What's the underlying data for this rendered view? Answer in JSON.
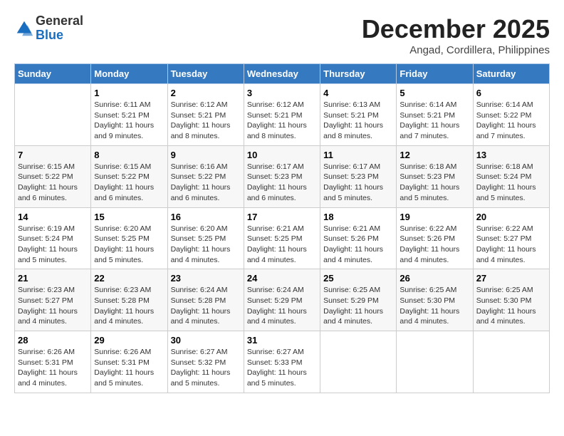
{
  "header": {
    "logo": {
      "general": "General",
      "blue": "Blue"
    },
    "title": "December 2025",
    "subtitle": "Angad, Cordillera, Philippines"
  },
  "days_of_week": [
    "Sunday",
    "Monday",
    "Tuesday",
    "Wednesday",
    "Thursday",
    "Friday",
    "Saturday"
  ],
  "weeks": [
    [
      {
        "day": "",
        "sunrise": "",
        "sunset": "",
        "daylight": ""
      },
      {
        "day": "1",
        "sunrise": "Sunrise: 6:11 AM",
        "sunset": "Sunset: 5:21 PM",
        "daylight": "Daylight: 11 hours and 9 minutes."
      },
      {
        "day": "2",
        "sunrise": "Sunrise: 6:12 AM",
        "sunset": "Sunset: 5:21 PM",
        "daylight": "Daylight: 11 hours and 8 minutes."
      },
      {
        "day": "3",
        "sunrise": "Sunrise: 6:12 AM",
        "sunset": "Sunset: 5:21 PM",
        "daylight": "Daylight: 11 hours and 8 minutes."
      },
      {
        "day": "4",
        "sunrise": "Sunrise: 6:13 AM",
        "sunset": "Sunset: 5:21 PM",
        "daylight": "Daylight: 11 hours and 8 minutes."
      },
      {
        "day": "5",
        "sunrise": "Sunrise: 6:14 AM",
        "sunset": "Sunset: 5:21 PM",
        "daylight": "Daylight: 11 hours and 7 minutes."
      },
      {
        "day": "6",
        "sunrise": "Sunrise: 6:14 AM",
        "sunset": "Sunset: 5:22 PM",
        "daylight": "Daylight: 11 hours and 7 minutes."
      }
    ],
    [
      {
        "day": "7",
        "sunrise": "Sunrise: 6:15 AM",
        "sunset": "Sunset: 5:22 PM",
        "daylight": "Daylight: 11 hours and 6 minutes."
      },
      {
        "day": "8",
        "sunrise": "Sunrise: 6:15 AM",
        "sunset": "Sunset: 5:22 PM",
        "daylight": "Daylight: 11 hours and 6 minutes."
      },
      {
        "day": "9",
        "sunrise": "Sunrise: 6:16 AM",
        "sunset": "Sunset: 5:22 PM",
        "daylight": "Daylight: 11 hours and 6 minutes."
      },
      {
        "day": "10",
        "sunrise": "Sunrise: 6:17 AM",
        "sunset": "Sunset: 5:23 PM",
        "daylight": "Daylight: 11 hours and 6 minutes."
      },
      {
        "day": "11",
        "sunrise": "Sunrise: 6:17 AM",
        "sunset": "Sunset: 5:23 PM",
        "daylight": "Daylight: 11 hours and 5 minutes."
      },
      {
        "day": "12",
        "sunrise": "Sunrise: 6:18 AM",
        "sunset": "Sunset: 5:23 PM",
        "daylight": "Daylight: 11 hours and 5 minutes."
      },
      {
        "day": "13",
        "sunrise": "Sunrise: 6:18 AM",
        "sunset": "Sunset: 5:24 PM",
        "daylight": "Daylight: 11 hours and 5 minutes."
      }
    ],
    [
      {
        "day": "14",
        "sunrise": "Sunrise: 6:19 AM",
        "sunset": "Sunset: 5:24 PM",
        "daylight": "Daylight: 11 hours and 5 minutes."
      },
      {
        "day": "15",
        "sunrise": "Sunrise: 6:20 AM",
        "sunset": "Sunset: 5:25 PM",
        "daylight": "Daylight: 11 hours and 5 minutes."
      },
      {
        "day": "16",
        "sunrise": "Sunrise: 6:20 AM",
        "sunset": "Sunset: 5:25 PM",
        "daylight": "Daylight: 11 hours and 4 minutes."
      },
      {
        "day": "17",
        "sunrise": "Sunrise: 6:21 AM",
        "sunset": "Sunset: 5:25 PM",
        "daylight": "Daylight: 11 hours and 4 minutes."
      },
      {
        "day": "18",
        "sunrise": "Sunrise: 6:21 AM",
        "sunset": "Sunset: 5:26 PM",
        "daylight": "Daylight: 11 hours and 4 minutes."
      },
      {
        "day": "19",
        "sunrise": "Sunrise: 6:22 AM",
        "sunset": "Sunset: 5:26 PM",
        "daylight": "Daylight: 11 hours and 4 minutes."
      },
      {
        "day": "20",
        "sunrise": "Sunrise: 6:22 AM",
        "sunset": "Sunset: 5:27 PM",
        "daylight": "Daylight: 11 hours and 4 minutes."
      }
    ],
    [
      {
        "day": "21",
        "sunrise": "Sunrise: 6:23 AM",
        "sunset": "Sunset: 5:27 PM",
        "daylight": "Daylight: 11 hours and 4 minutes."
      },
      {
        "day": "22",
        "sunrise": "Sunrise: 6:23 AM",
        "sunset": "Sunset: 5:28 PM",
        "daylight": "Daylight: 11 hours and 4 minutes."
      },
      {
        "day": "23",
        "sunrise": "Sunrise: 6:24 AM",
        "sunset": "Sunset: 5:28 PM",
        "daylight": "Daylight: 11 hours and 4 minutes."
      },
      {
        "day": "24",
        "sunrise": "Sunrise: 6:24 AM",
        "sunset": "Sunset: 5:29 PM",
        "daylight": "Daylight: 11 hours and 4 minutes."
      },
      {
        "day": "25",
        "sunrise": "Sunrise: 6:25 AM",
        "sunset": "Sunset: 5:29 PM",
        "daylight": "Daylight: 11 hours and 4 minutes."
      },
      {
        "day": "26",
        "sunrise": "Sunrise: 6:25 AM",
        "sunset": "Sunset: 5:30 PM",
        "daylight": "Daylight: 11 hours and 4 minutes."
      },
      {
        "day": "27",
        "sunrise": "Sunrise: 6:25 AM",
        "sunset": "Sunset: 5:30 PM",
        "daylight": "Daylight: 11 hours and 4 minutes."
      }
    ],
    [
      {
        "day": "28",
        "sunrise": "Sunrise: 6:26 AM",
        "sunset": "Sunset: 5:31 PM",
        "daylight": "Daylight: 11 hours and 4 minutes."
      },
      {
        "day": "29",
        "sunrise": "Sunrise: 6:26 AM",
        "sunset": "Sunset: 5:31 PM",
        "daylight": "Daylight: 11 hours and 5 minutes."
      },
      {
        "day": "30",
        "sunrise": "Sunrise: 6:27 AM",
        "sunset": "Sunset: 5:32 PM",
        "daylight": "Daylight: 11 hours and 5 minutes."
      },
      {
        "day": "31",
        "sunrise": "Sunrise: 6:27 AM",
        "sunset": "Sunset: 5:33 PM",
        "daylight": "Daylight: 11 hours and 5 minutes."
      },
      {
        "day": "",
        "sunrise": "",
        "sunset": "",
        "daylight": ""
      },
      {
        "day": "",
        "sunrise": "",
        "sunset": "",
        "daylight": ""
      },
      {
        "day": "",
        "sunrise": "",
        "sunset": "",
        "daylight": ""
      }
    ]
  ]
}
